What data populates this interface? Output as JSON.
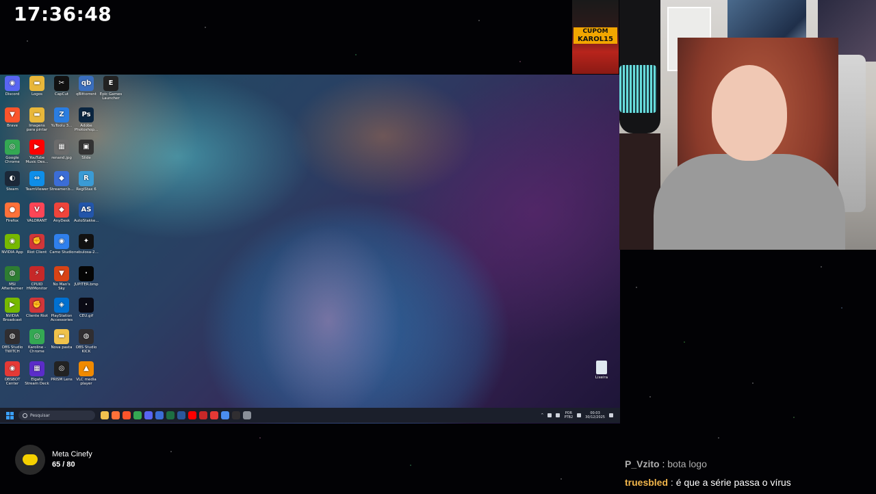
{
  "overlay": {
    "clock": "17:36:48",
    "coupon": {
      "line1": "CUPOM",
      "code": "KAROL15",
      "color": "#f2a600"
    },
    "goal": {
      "title": "Meta Cinefy",
      "value": "65 / 80",
      "logo_icon": "cinefy-logo-icon",
      "accent": "#f5d000"
    }
  },
  "desktop": {
    "wallpaper": "bubble-nebula",
    "icons": [
      {
        "label": "Discord",
        "icon": "discord-icon",
        "color": "#5865f2",
        "glyph": "◉"
      },
      {
        "label": "Logos",
        "icon": "folder-icon",
        "color": "#e8b73a",
        "glyph": "▬"
      },
      {
        "label": "CapCut",
        "icon": "capcut-icon",
        "color": "#111111",
        "glyph": "✂"
      },
      {
        "label": "qBittorrent",
        "icon": "qbittorrent-icon",
        "color": "#3a6fbf",
        "glyph": "qb"
      },
      {
        "label": "Epic Games Launcher",
        "icon": "epic-games-icon",
        "color": "#222222",
        "glyph": "E"
      },
      {
        "label": "Brave",
        "icon": "brave-icon",
        "color": "#fb542b",
        "glyph": "▼"
      },
      {
        "label": "Imagens para pintar",
        "icon": "folder-icon",
        "color": "#e8b73a",
        "glyph": "▬"
      },
      {
        "label": "YuToolu 3...",
        "icon": "yutoolu-icon",
        "color": "#2a7de1",
        "glyph": "Z"
      },
      {
        "label": "Adobe Photoshop...",
        "icon": "photoshop-icon",
        "color": "#0a2540",
        "glyph": "Ps"
      },
      {
        "label": "",
        "icon": "",
        "color": "",
        "glyph": ""
      },
      {
        "label": "Google Chrome",
        "icon": "chrome-icon",
        "color": "#34a853",
        "glyph": "◎"
      },
      {
        "label": "YouTube Music Des...",
        "icon": "youtube-music-icon",
        "color": "#ff0000",
        "glyph": "▶"
      },
      {
        "label": "renand.jpg",
        "icon": "image-file-icon",
        "color": "#6b6b6b",
        "glyph": "▦"
      },
      {
        "label": "Slide",
        "icon": "video-file-icon",
        "color": "#333333",
        "glyph": "▣"
      },
      {
        "label": "",
        "icon": "",
        "color": "",
        "glyph": ""
      },
      {
        "label": "Steam",
        "icon": "steam-icon",
        "color": "#1b2838",
        "glyph": "◐"
      },
      {
        "label": "TeamViewer",
        "icon": "teamviewer-icon",
        "color": "#0e8ee9",
        "glyph": "⇔"
      },
      {
        "label": "Streamer.b...",
        "icon": "streamerbot-icon",
        "color": "#3b6dd6",
        "glyph": "◆"
      },
      {
        "label": "RegiStax 6",
        "icon": "registax-icon",
        "color": "#3a9bd5",
        "glyph": "R"
      },
      {
        "label": "",
        "icon": "",
        "color": "",
        "glyph": ""
      },
      {
        "label": "Firefox",
        "icon": "firefox-icon",
        "color": "#ff7139",
        "glyph": "●"
      },
      {
        "label": "VALORANT",
        "icon": "valorant-icon",
        "color": "#fd4556",
        "glyph": "V"
      },
      {
        "label": "AnyDesk",
        "icon": "anydesk-icon",
        "color": "#ef443b",
        "glyph": "◆"
      },
      {
        "label": "AutoStakke...",
        "icon": "autostakkert-icon",
        "color": "#2255aa",
        "glyph": "AS"
      },
      {
        "label": "",
        "icon": "",
        "color": "",
        "glyph": ""
      },
      {
        "label": "NVIDIA App",
        "icon": "nvidia-icon",
        "color": "#76b900",
        "glyph": "◉"
      },
      {
        "label": "Riot Client",
        "icon": "riot-client-icon",
        "color": "#d13639",
        "glyph": "✊"
      },
      {
        "label": "Camo Studio",
        "icon": "camo-icon",
        "color": "#2f80ed",
        "glyph": "◉"
      },
      {
        "label": "nebulosa-2...",
        "icon": "image-file-icon",
        "color": "#111111",
        "glyph": "✦"
      },
      {
        "label": "",
        "icon": "",
        "color": "",
        "glyph": ""
      },
      {
        "label": "MSI Afterburner",
        "icon": "msi-afterburner-icon",
        "color": "#2e7d32",
        "glyph": "◍"
      },
      {
        "label": "CPUID HWMonitor",
        "icon": "hwmonitor-icon",
        "color": "#c62828",
        "glyph": "⚡"
      },
      {
        "label": "No Man's Sky",
        "icon": "no-mans-sky-icon",
        "color": "#d84315",
        "glyph": "▼"
      },
      {
        "label": "JUPITER.bmp",
        "icon": "image-file-icon",
        "color": "#050505",
        "glyph": "·"
      },
      {
        "label": "",
        "icon": "",
        "color": "",
        "glyph": ""
      },
      {
        "label": "NVIDIA Broadcast",
        "icon": "nvidia-broadcast-icon",
        "color": "#76b900",
        "glyph": "▶"
      },
      {
        "label": "Cliente Riot",
        "icon": "riot-client-icon",
        "color": "#d13639",
        "glyph": "✊"
      },
      {
        "label": "PlayStation Accessories",
        "icon": "playstation-icon",
        "color": "#0070d1",
        "glyph": "◈"
      },
      {
        "label": "CEU.gif",
        "icon": "image-file-icon",
        "color": "#0a0a14",
        "glyph": "·"
      },
      {
        "label": "",
        "icon": "",
        "color": "",
        "glyph": ""
      },
      {
        "label": "OBS Studio TWITCH",
        "icon": "obs-icon",
        "color": "#302e31",
        "glyph": "◍"
      },
      {
        "label": "Karoline - Chrome",
        "icon": "chrome-icon",
        "color": "#34a853",
        "glyph": "◎"
      },
      {
        "label": "Nova pasta",
        "icon": "folder-icon",
        "color": "#f0c24b",
        "glyph": "▬"
      },
      {
        "label": "OBS Studio KICK",
        "icon": "obs-icon",
        "color": "#302e31",
        "glyph": "◍"
      },
      {
        "label": "",
        "icon": "",
        "color": "",
        "glyph": ""
      },
      {
        "label": "OBSBOT Center",
        "icon": "obsbot-icon",
        "color": "#e53935",
        "glyph": "◉"
      },
      {
        "label": "Elgato Stream Deck",
        "icon": "stream-deck-icon",
        "color": "#5b2cc9",
        "glyph": "▦"
      },
      {
        "label": "PRISM Lens",
        "icon": "prism-icon",
        "color": "#222222",
        "glyph": "◎"
      },
      {
        "label": "VLC media player",
        "icon": "vlc-icon",
        "color": "#f08a00",
        "glyph": "▲"
      }
    ],
    "recycle_bin": "Lixeira",
    "taskbar": {
      "search_placeholder": "Pesquisar",
      "apps": [
        {
          "icon": "file-explorer-icon",
          "color": "#f2c14e"
        },
        {
          "icon": "firefox-icon",
          "color": "#ff7139"
        },
        {
          "icon": "brave-icon",
          "color": "#fb542b"
        },
        {
          "icon": "chrome-icon",
          "color": "#34a853"
        },
        {
          "icon": "discord-icon",
          "color": "#5865f2"
        },
        {
          "icon": "streamerbot-icon",
          "color": "#3b6dd6"
        },
        {
          "icon": "excel-icon",
          "color": "#1d6f42"
        },
        {
          "icon": "word-icon",
          "color": "#2b579a"
        },
        {
          "icon": "youtube-music-icon",
          "color": "#ff0000"
        },
        {
          "icon": "hwmonitor-icon",
          "color": "#c62828"
        },
        {
          "icon": "obsbot-icon",
          "color": "#e53935"
        },
        {
          "icon": "chrome-profile-icon",
          "color": "#4a8df0"
        },
        {
          "icon": "obs-icon",
          "color": "#302e31"
        },
        {
          "icon": "settings-icon",
          "color": "#8a8f99"
        }
      ],
      "tray": {
        "language": "POR",
        "layout": "PTB2",
        "time": "00:03",
        "date": "30/12/2025"
      }
    }
  },
  "chat": [
    {
      "user": "P_Vzito",
      "user_color": "#b0b0b0",
      "text": "bota logo",
      "text_color": "#b0b0b0"
    },
    {
      "user": "truesbled",
      "user_color": "#f2b64b",
      "text": "é que a série passa o vírus",
      "text_color": "#ffffff"
    }
  ]
}
